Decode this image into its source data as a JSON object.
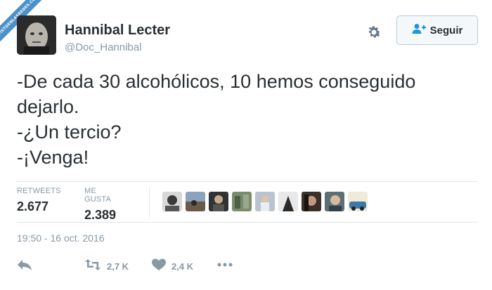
{
  "watermark": "VISTOENLASREDES.COM",
  "user": {
    "display_name": "Hannibal Lecter",
    "handle": "@Doc_Hannibal"
  },
  "follow_button": {
    "label": "Seguir"
  },
  "tweet": {
    "lines": [
      "-De cada 30 alcohólicos, 10 hemos conseguido dejarlo.",
      "-¿Un tercio?",
      "-¡Venga!"
    ]
  },
  "stats": {
    "retweets_label": "RETWEETS",
    "retweets_value": "2.677",
    "likes_label": "ME GUSTA",
    "likes_value": "2.389"
  },
  "timestamp": "19:50 - 16 oct. 2016",
  "actions": {
    "retweet_count": "2,7 K",
    "like_count": "2,4 K"
  },
  "colors": {
    "text": "#292f33",
    "muted": "#8899a6",
    "link_blue": "#1b95e0",
    "divider": "#e1e8ed"
  },
  "icons": [
    "gear-icon",
    "add-user-icon",
    "reply-icon",
    "retweet-icon",
    "heart-icon",
    "more-icon"
  ]
}
